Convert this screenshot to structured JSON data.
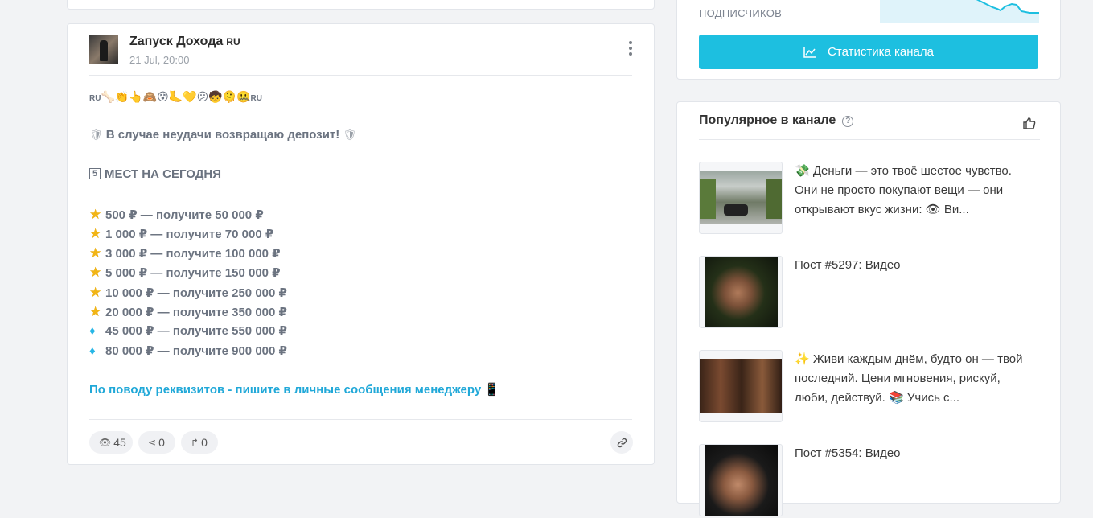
{
  "post": {
    "channel_name": "Zапуск Дохода",
    "channel_lang": "RU",
    "date": "21 Jul, 20:00",
    "emoji_line": {
      "prefix": "RU",
      "emojis": "🦴👏👆🙈😵🦶💛😕🧒🫠🤐",
      "suffix": "RU"
    },
    "deposit_line": "В случае неудачи возвращаю депозит!",
    "places_number": "5",
    "places_line": "МЕСТ НА СЕГОДНЯ",
    "offers": [
      {
        "icon": "star",
        "text": "500 ₽ — получите 50 000 ₽"
      },
      {
        "icon": "star",
        "text": "1 000 ₽ — получите 70 000 ₽"
      },
      {
        "icon": "star",
        "text": "3 000 ₽ — получите 100 000 ₽"
      },
      {
        "icon": "star",
        "text": "5 000 ₽ — получите 150 000 ₽"
      },
      {
        "icon": "star",
        "text": "10 000 ₽ — получите 250 000 ₽"
      },
      {
        "icon": "star",
        "text": "20 000 ₽ — получите 350 000 ₽"
      },
      {
        "icon": "diamond",
        "text": "45 000 ₽ — получите 550 000 ₽"
      },
      {
        "icon": "diamond",
        "text": "80 000 ₽ — получите 900 000 ₽"
      }
    ],
    "contact_line": "По поводу реквизитов - пишите в личные сообщения менеджеру",
    "contact_emoji": "📱",
    "views": "45",
    "shares": "0",
    "forwards": "0"
  },
  "stats": {
    "subscribers_label": "ПОДПИСЧИКОВ",
    "button_label": "Статистика канала"
  },
  "popular": {
    "title": "Популярное в канале",
    "help_glyph": "?",
    "items": [
      {
        "emoji": "💸",
        "text": "Деньги — это твоё шестое чувство. Они не просто покупают вещи — они открывают вкус жизни: 👁 Ви..."
      },
      {
        "emoji": "",
        "text": "Пост #5297: Видео"
      },
      {
        "emoji": "✨",
        "text": "Живи каждым днём, будто он — твой последний. Цени мгновения, рискуй, люби, действуй. 📚 Учись с..."
      },
      {
        "emoji": "",
        "text": "Пост #5354: Видео"
      }
    ]
  },
  "colors": {
    "accent": "#1dbfe0",
    "link": "#20a8d8",
    "star": "#f2b515",
    "diamond": "#27b6e6"
  }
}
